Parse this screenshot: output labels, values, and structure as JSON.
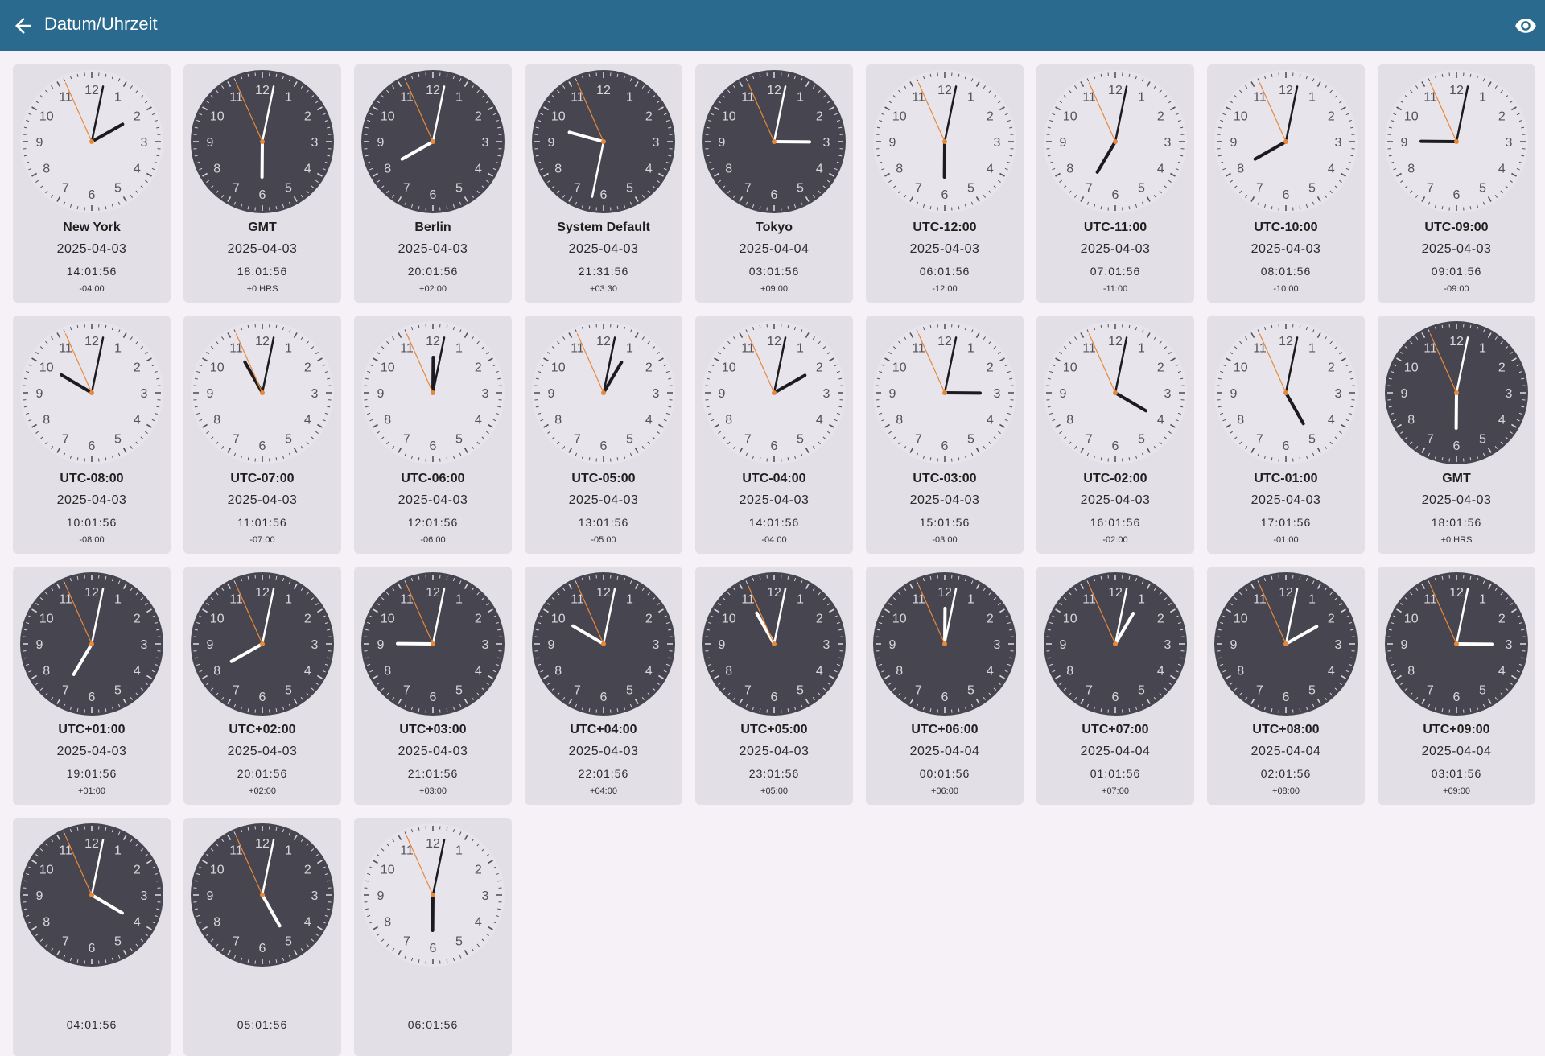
{
  "app_bar": {
    "title": "Datum/Uhrzeit",
    "back_icon": "arrow-back-icon",
    "visibility_icon": "eye-icon"
  },
  "clock_colors": {
    "dark_face": "#47454f",
    "light_face": "#e8e4ec",
    "second_hand": "#e8893a"
  },
  "clocks": [
    {
      "name": "New York",
      "date": "2025-04-03",
      "time": "14:01:56",
      "offset": "-04:00",
      "dark": false
    },
    {
      "name": "GMT",
      "date": "2025-04-03",
      "time": "18:01:56",
      "offset": "+0 HRS",
      "dark": true
    },
    {
      "name": "Berlin",
      "date": "2025-04-03",
      "time": "20:01:56",
      "offset": "+02:00",
      "dark": true
    },
    {
      "name": "System Default",
      "date": "2025-04-03",
      "time": "21:31:56",
      "offset": "+03:30",
      "dark": true
    },
    {
      "name": "Tokyo",
      "date": "2025-04-04",
      "time": "03:01:56",
      "offset": "+09:00",
      "dark": true
    },
    {
      "name": "UTC-12:00",
      "date": "2025-04-03",
      "time": "06:01:56",
      "offset": "-12:00",
      "dark": false
    },
    {
      "name": "UTC-11:00",
      "date": "2025-04-03",
      "time": "07:01:56",
      "offset": "-11:00",
      "dark": false
    },
    {
      "name": "UTC-10:00",
      "date": "2025-04-03",
      "time": "08:01:56",
      "offset": "-10:00",
      "dark": false
    },
    {
      "name": "UTC-09:00",
      "date": "2025-04-03",
      "time": "09:01:56",
      "offset": "-09:00",
      "dark": false
    },
    {
      "name": "UTC-08:00",
      "date": "2025-04-03",
      "time": "10:01:56",
      "offset": "-08:00",
      "dark": false
    },
    {
      "name": "UTC-07:00",
      "date": "2025-04-03",
      "time": "11:01:56",
      "offset": "-07:00",
      "dark": false
    },
    {
      "name": "UTC-06:00",
      "date": "2025-04-03",
      "time": "12:01:56",
      "offset": "-06:00",
      "dark": false
    },
    {
      "name": "UTC-05:00",
      "date": "2025-04-03",
      "time": "13:01:56",
      "offset": "-05:00",
      "dark": false
    },
    {
      "name": "UTC-04:00",
      "date": "2025-04-03",
      "time": "14:01:56",
      "offset": "-04:00",
      "dark": false
    },
    {
      "name": "UTC-03:00",
      "date": "2025-04-03",
      "time": "15:01:56",
      "offset": "-03:00",
      "dark": false
    },
    {
      "name": "UTC-02:00",
      "date": "2025-04-03",
      "time": "16:01:56",
      "offset": "-02:00",
      "dark": false
    },
    {
      "name": "UTC-01:00",
      "date": "2025-04-03",
      "time": "17:01:56",
      "offset": "-01:00",
      "dark": false
    },
    {
      "name": "GMT",
      "date": "2025-04-03",
      "time": "18:01:56",
      "offset": "+0 HRS",
      "dark": true
    },
    {
      "name": "UTC+01:00",
      "date": "2025-04-03",
      "time": "19:01:56",
      "offset": "+01:00",
      "dark": true
    },
    {
      "name": "UTC+02:00",
      "date": "2025-04-03",
      "time": "20:01:56",
      "offset": "+02:00",
      "dark": true
    },
    {
      "name": "UTC+03:00",
      "date": "2025-04-03",
      "time": "21:01:56",
      "offset": "+03:00",
      "dark": true
    },
    {
      "name": "UTC+04:00",
      "date": "2025-04-03",
      "time": "22:01:56",
      "offset": "+04:00",
      "dark": true
    },
    {
      "name": "UTC+05:00",
      "date": "2025-04-03",
      "time": "23:01:56",
      "offset": "+05:00",
      "dark": true
    },
    {
      "name": "UTC+06:00",
      "date": "2025-04-04",
      "time": "00:01:56",
      "offset": "+06:00",
      "dark": true
    },
    {
      "name": "UTC+07:00",
      "date": "2025-04-04",
      "time": "01:01:56",
      "offset": "+07:00",
      "dark": true
    },
    {
      "name": "UTC+08:00",
      "date": "2025-04-04",
      "time": "02:01:56",
      "offset": "+08:00",
      "dark": true
    },
    {
      "name": "UTC+09:00",
      "date": "2025-04-04",
      "time": "03:01:56",
      "offset": "+09:00",
      "dark": true
    },
    {
      "name": "",
      "date": "",
      "time": "04:01:56",
      "offset": "",
      "dark": true
    },
    {
      "name": "",
      "date": "",
      "time": "05:01:56",
      "offset": "",
      "dark": true
    },
    {
      "name": "",
      "date": "",
      "time": "06:01:56",
      "offset": "",
      "dark": false
    }
  ]
}
